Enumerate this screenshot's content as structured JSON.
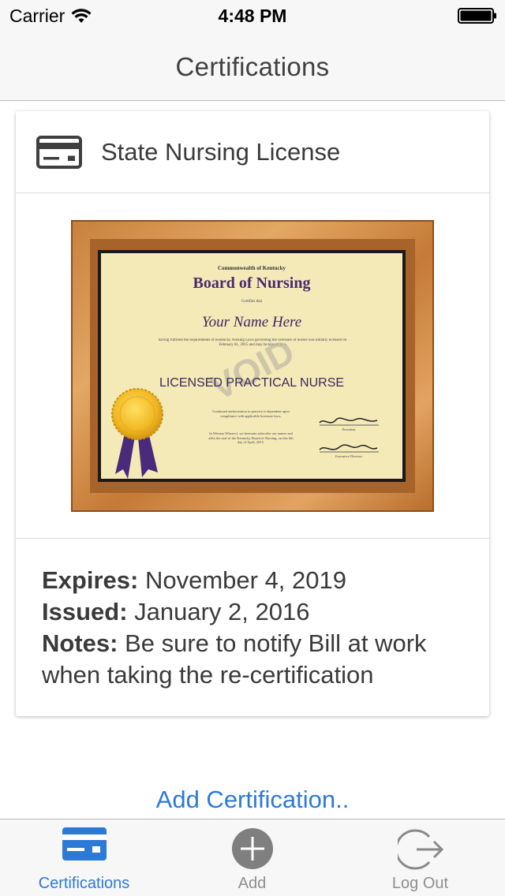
{
  "status_bar": {
    "carrier": "Carrier",
    "time": "4:48 PM"
  },
  "nav": {
    "title": "Certifications"
  },
  "card": {
    "icon": "credit-card-icon",
    "title": "State Nursing License",
    "certificate": {
      "org_small": "Commonwealth of Kentucky",
      "org": "Board of Nursing",
      "certifies": "Certifies that",
      "name": "Your Name Here",
      "body": "having fulfilled the requirements of Kentucky Nursing Laws governing the licensure of nurses was initially licensed on February 61, 2015 and may be known as a",
      "designation": "LICENSED PRACTICAL NURSE",
      "watermark": "VOID",
      "footer_left": "Continued authorization to practice is dependent upon compliance with applicable licensure laws.",
      "footer_left2": "In Witness Whereof, we hereunto subscribe our names and affix the seal of the Kentucky Board of Nursing, on this 6th day of April, 2015.",
      "sig1": "President",
      "sig2": "Executive Director"
    },
    "details": {
      "expires_label": "Expires:",
      "expires_value": " November 4, 2019",
      "issued_label": "Issued:",
      "issued_value": " January 2, 2016",
      "notes_label": "Notes:",
      "notes_value": " Be sure to notify Bill at work when taking the re-certification"
    }
  },
  "add_link": "Add Certification..",
  "tabs": [
    {
      "label": "Certifications",
      "icon": "credit-card-icon",
      "active": true
    },
    {
      "label": "Add",
      "icon": "plus-circle-icon",
      "active": false
    },
    {
      "label": "Log Out",
      "icon": "logout-icon",
      "active": false
    }
  ],
  "colors": {
    "accent": "#2d7ad6",
    "inactive": "#8e8e8e",
    "bar_bg": "#f7f7f7"
  }
}
